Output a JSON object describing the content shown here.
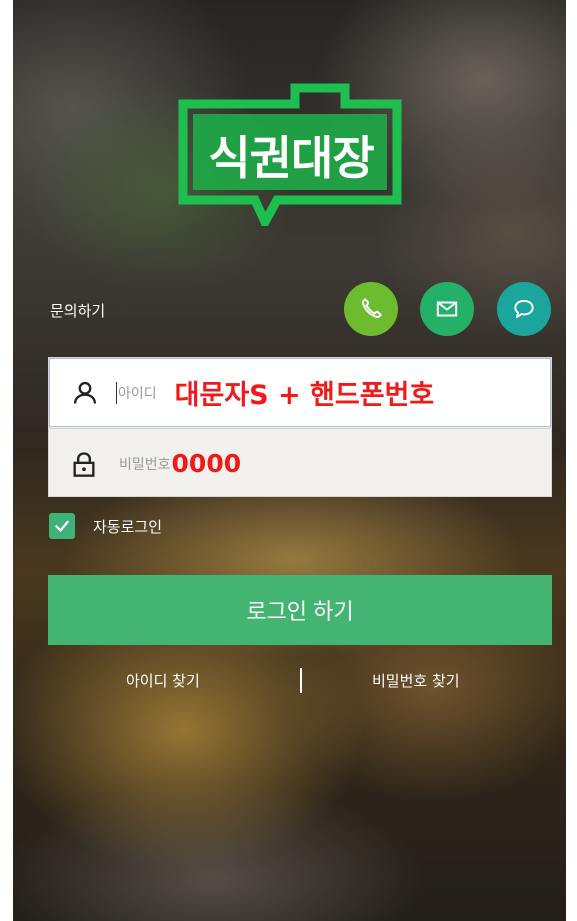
{
  "logo": {
    "text": "식권대장",
    "icon": "logo-speech-frame"
  },
  "contact": {
    "label": "문의하기",
    "buttons": [
      {
        "name": "phone-icon",
        "color": "#6dbb2f"
      },
      {
        "name": "mail-icon",
        "color": "#25b06a"
      },
      {
        "name": "chat-icon",
        "color": "#1aa69d"
      }
    ]
  },
  "form": {
    "id_placeholder": "아이디",
    "id_hint": "대문자S + 핸드폰번호",
    "pw_placeholder": "비밀번호",
    "pw_hint": "0000",
    "id_icon": "user-icon",
    "pw_icon": "lock-icon"
  },
  "auto_login": {
    "label": "자동로그인",
    "checked": true
  },
  "login_button": {
    "label": "로그인 하기"
  },
  "links": {
    "find_id": "아이디 찾기",
    "find_pw": "비밀번호 찾기"
  },
  "colors": {
    "accent_green": "#43b472",
    "logo_green": "#1fbf4f",
    "hint_red": "#f01a1a"
  }
}
